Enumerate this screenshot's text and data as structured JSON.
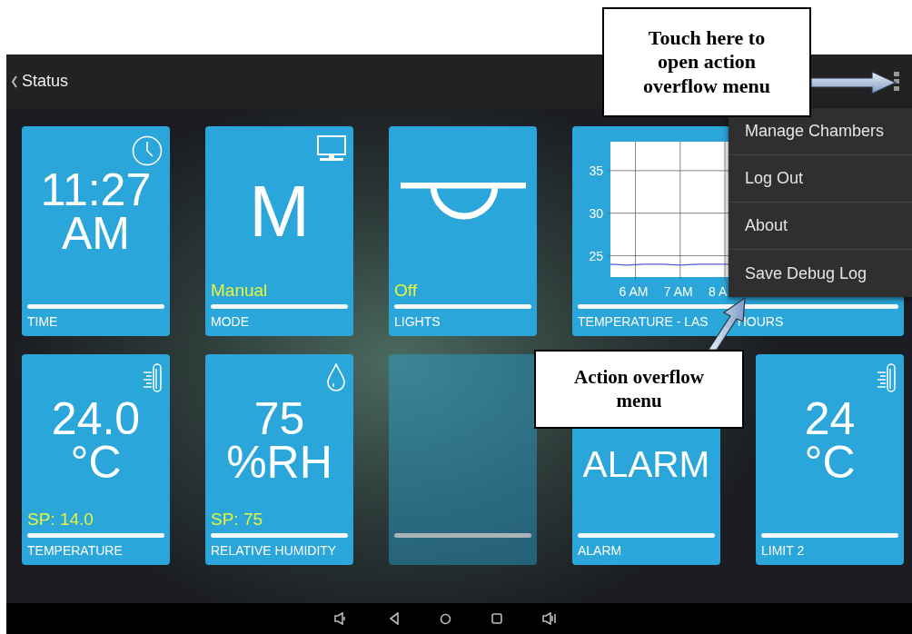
{
  "header": {
    "title": "Status"
  },
  "tiles": [
    {
      "kind": "time",
      "value_lines": [
        "11:27",
        "AM"
      ],
      "label": "TIME",
      "disabled": false
    },
    {
      "kind": "mode",
      "value_lines": [
        "M"
      ],
      "subvalue": "Manual",
      "label": "MODE",
      "disabled": false
    },
    {
      "kind": "lights",
      "subvalue": "Off",
      "label": "LIGHTS",
      "disabled": false
    },
    {
      "kind": "chart",
      "label_parts": [
        "TEMPERATURE - LAS",
        "HOURS"
      ],
      "disabled": false,
      "chart_data": {
        "type": "line",
        "grid": true,
        "x": [
          5.44,
          5.8,
          6.2,
          6.6,
          7,
          7.4,
          7.8,
          8.08
        ],
        "series": [
          {
            "color": "#5a5ae0",
            "values": [
              24,
              23.9,
              24,
              24,
              23.9,
              24,
              24,
              24
            ]
          }
        ],
        "xlim": [
          5.44,
          8.08
        ],
        "ylim": [
          22.5,
          38.4
        ],
        "xticks": [
          {
            "value": 6,
            "label": "6 AM"
          },
          {
            "value": 7,
            "label": "7 AM"
          },
          {
            "value": 8,
            "label": "8 A"
          }
        ],
        "yticks": [
          25,
          30,
          35
        ]
      }
    },
    {
      "kind": "temperature",
      "value_lines": [
        "24.0",
        "°C"
      ],
      "subvalue": "SP: 14.0",
      "label": "TEMPERATURE",
      "disabled": false
    },
    {
      "kind": "humidity",
      "value_lines": [
        "75",
        "%RH"
      ],
      "subvalue": "SP: 75",
      "label": "RELATIVE HUMIDITY",
      "disabled": false
    },
    {
      "kind": "blank",
      "disabled": true
    },
    {
      "kind": "alarm",
      "value_lines": [
        "ALARM"
      ],
      "label": "ALARM",
      "disabled": false
    },
    {
      "kind": "temperature",
      "value_lines": [
        "24",
        "°C"
      ],
      "label": "LIMIT 2",
      "disabled": false
    }
  ],
  "overflow_menu": {
    "items": [
      "Manage Chambers",
      "Log Out",
      "About",
      "Save Debug Log"
    ]
  },
  "annotations": [
    {
      "lines": [
        "Touch here to",
        "open action",
        "overflow menu"
      ]
    },
    {
      "lines": [
        "Action overflow",
        "menu"
      ]
    }
  ]
}
